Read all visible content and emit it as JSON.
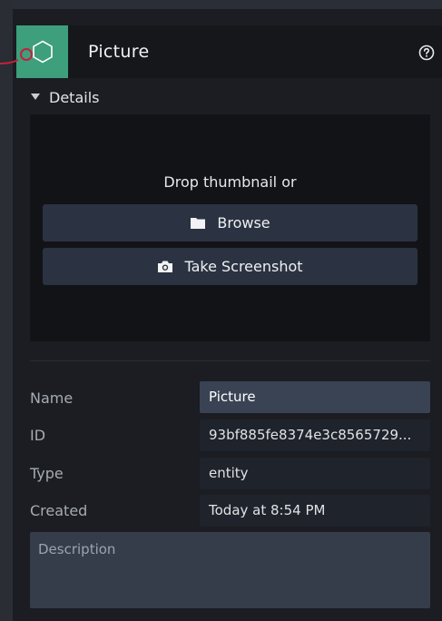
{
  "node": {
    "title": "Picture",
    "icon": "hexagon-icon",
    "color": "#3d9f7c",
    "connector_color": "#c4213b",
    "help_icon": "question-circle-icon"
  },
  "details": {
    "section_label": "Details",
    "drop_text": "Drop thumbnail or",
    "browse_label": "Browse",
    "browse_icon": "folder-icon",
    "screenshot_label": "Take Screenshot",
    "screenshot_icon": "camera-icon"
  },
  "properties": [
    {
      "label": "Name",
      "value": "Picture"
    },
    {
      "label": "ID",
      "value": "93bf885fe8374e3c8565729..."
    },
    {
      "label": "Type",
      "value": "entity"
    },
    {
      "label": "Created",
      "value": "Today at 8:54 PM"
    }
  ],
  "description": {
    "placeholder": "Description"
  }
}
